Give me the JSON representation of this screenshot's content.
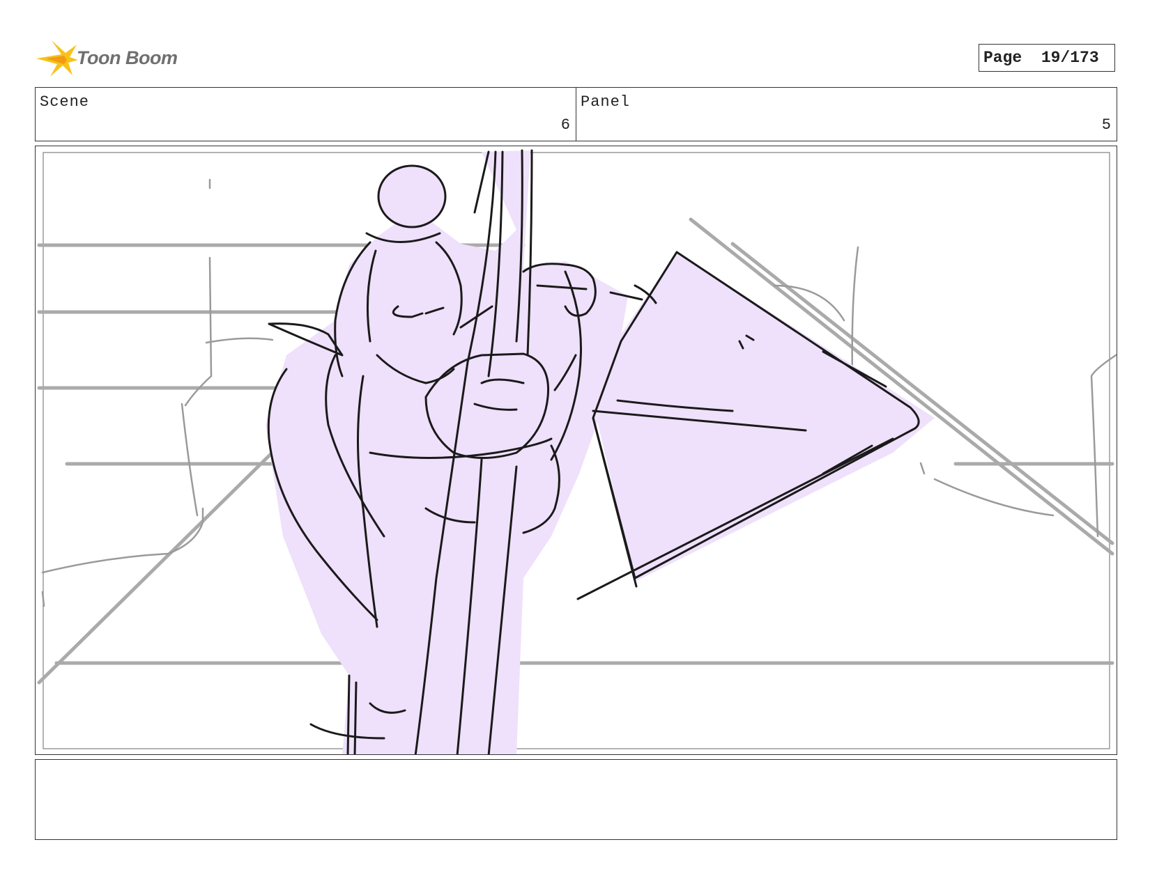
{
  "header": {
    "logo_text": "Toon Boom",
    "page_label": "Page",
    "page_number": "19/173"
  },
  "info": {
    "scene_label": "Scene",
    "scene_value": "6",
    "panel_label": "Panel",
    "panel_value": "5"
  },
  "panel": {
    "fill_color": "#efe0fb",
    "line_color": "#1a1a1a",
    "background_line_color": "#aaaaaa"
  },
  "notes": {
    "text": ""
  }
}
